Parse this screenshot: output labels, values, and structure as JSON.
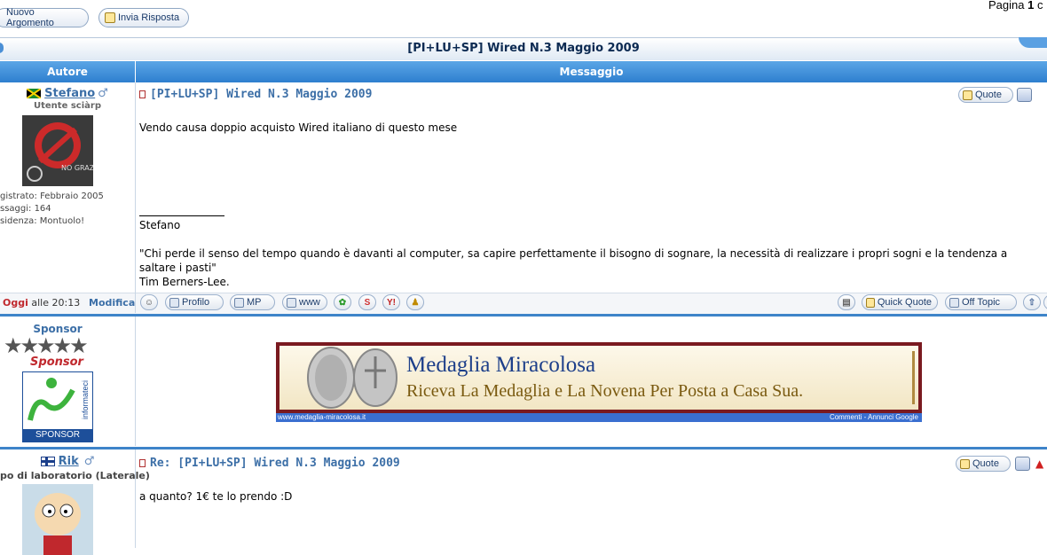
{
  "top": {
    "new_topic": "Nuovo Argomento",
    "reply": "Invia Risposta",
    "pagination_prefix": "Pagina ",
    "pagination_page": "1",
    "pagination_suffix": " c"
  },
  "topic": {
    "title": "[PI+LU+SP] Wired N.3 Maggio 2009"
  },
  "table": {
    "author_header": "Autore",
    "message_header": "Messaggio"
  },
  "post1": {
    "author": "Stefano",
    "rank": "Utente sciàrp",
    "registered": "gistrato: Febbraio 2005",
    "messages": "ssaggi: 164",
    "residence": "sidenza: Montuolo!",
    "title": "[PI+LU+SP] Wired N.3 Maggio 2009",
    "body": "Vendo causa doppio acquisto Wired italiano di questo mese",
    "sig_line": "____________",
    "sig_name": "Stefano",
    "sig_quote_1": "\"Chi perde il senso del tempo quando è davanti al computer, sa capire perfettamente il bisogno di sognare, la necessità di realizzare i propri sogni e la tendenza a",
    "sig_quote_2": "saltare i pasti\"",
    "sig_author": "Tim Berners-Lee.",
    "date_day": "Oggi",
    "date_time": " alle 20:13",
    "edit": "Modifica",
    "quote_btn": "Quote",
    "buttons": {
      "profile": "Profilo",
      "pm": "MP",
      "www": "www",
      "quick_quote": "Quick Quote",
      "off_topic": "Off Topic"
    }
  },
  "sponsor": {
    "name": "Sponsor",
    "rank_img_text": "Sponsor",
    "logo_side": "informateci",
    "logo_bottom": "SPONSOR",
    "ad_title": "Medaglia Miracolosa",
    "ad_subtitle": "Riceva La Medaglia e La Novena Per Posta a Casa Sua.",
    "ad_url": "www.medaglia-miracolosa.it",
    "ad_footer": "Commenti - Annunci Google"
  },
  "post2": {
    "author": "Rik",
    "rank": "po di laboratorio (Laterale)",
    "title": "Re: [PI+LU+SP] Wired N.3 Maggio 2009",
    "body": "a quanto? 1€ te lo prendo :D",
    "quote_btn": "Quote"
  },
  "colors": {
    "header_blue": "#2e7fcf",
    "link_blue": "#3c6fa7",
    "date_red": "#c0282d"
  }
}
